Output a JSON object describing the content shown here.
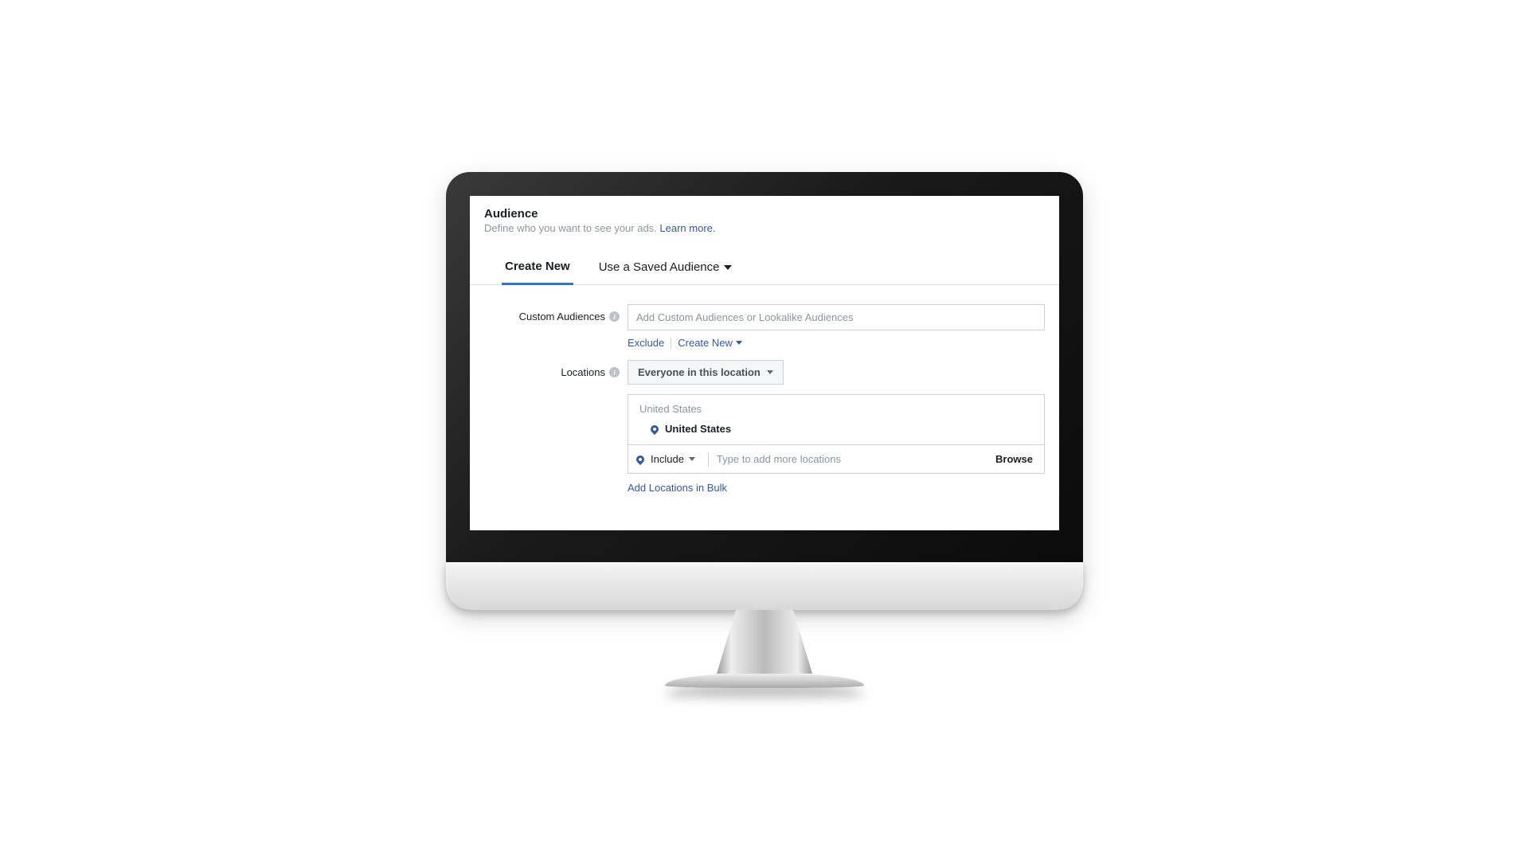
{
  "header": {
    "title": "Audience",
    "subtitle_prefix": "Define who you want to see your ads. ",
    "learn_more": "Learn more."
  },
  "tabs": {
    "create_new": "Create New",
    "saved": "Use a Saved Audience"
  },
  "custom_audiences": {
    "label": "Custom Audiences",
    "placeholder": "Add Custom Audiences or Lookalike Audiences",
    "exclude": "Exclude",
    "create_new": "Create New"
  },
  "locations": {
    "label": "Locations",
    "scope": "Everyone in this location",
    "group_header": "United States",
    "selected_item": "United States",
    "include_label": "Include",
    "add_placeholder": "Type to add more locations",
    "browse": "Browse",
    "bulk": "Add Locations in Bulk"
  }
}
